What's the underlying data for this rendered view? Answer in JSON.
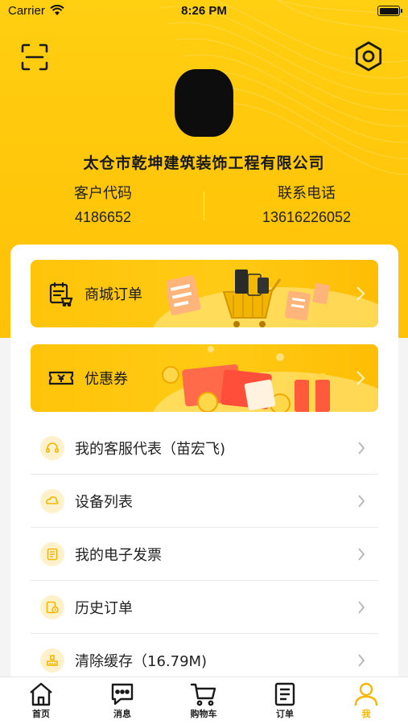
{
  "status_bar": {
    "carrier": "Carrier",
    "time": "8:26 PM"
  },
  "profile": {
    "company": "太仓市乾坤建筑装饰工程有限公司",
    "customer_code_label": "客户代码",
    "customer_code": "4186652",
    "phone_label": "联系电话",
    "phone": "13616226052"
  },
  "banners": [
    {
      "label": "商城订单",
      "icon": "cart-list-icon"
    },
    {
      "label": "优惠券",
      "icon": "ticket-icon"
    }
  ],
  "menu": [
    {
      "label": "我的客服代表（苗宏飞)",
      "icon": "headset-icon"
    },
    {
      "label": "设备列表",
      "icon": "device-icon"
    },
    {
      "label": "我的电子发票",
      "icon": "invoice-icon"
    },
    {
      "label": "历史订单",
      "icon": "history-icon"
    },
    {
      "label": "清除缓存（16.79M)",
      "icon": "broom-icon"
    }
  ],
  "tabs": [
    {
      "label": "首页",
      "icon": "home-icon"
    },
    {
      "label": "消息",
      "icon": "message-icon"
    },
    {
      "label": "购物车",
      "icon": "cart-icon"
    },
    {
      "label": "订单",
      "icon": "order-icon"
    },
    {
      "label": "我",
      "icon": "user-icon",
      "active": true
    }
  ],
  "colors": {
    "brand": "#ffc60a",
    "active_tab": "#f5b700",
    "icon_bg": "#fff1cc"
  }
}
